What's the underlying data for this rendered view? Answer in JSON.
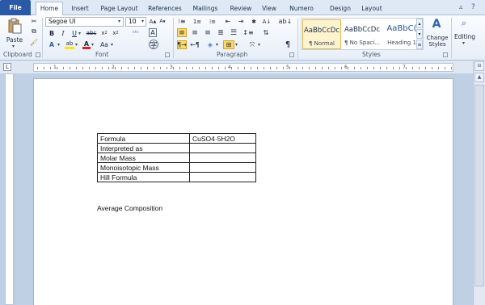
{
  "tabs": {
    "file": "File",
    "items": [
      "Home",
      "Insert",
      "Page Layout",
      "References",
      "Mailings",
      "Review",
      "View",
      "Numero",
      "Design",
      "Layout"
    ]
  },
  "clipboard": {
    "paste": "Paste",
    "label": "Clipboard"
  },
  "font": {
    "name": "Segoe UI",
    "size": "10",
    "label": "Font"
  },
  "paragraph": {
    "label": "Paragraph"
  },
  "styles": {
    "label": "Styles",
    "items": [
      {
        "sample": "AaBbCcDc",
        "name": "¶ Normal"
      },
      {
        "sample": "AaBbCcDc",
        "name": "¶ No Spaci..."
      },
      {
        "sample": "AaBbC(",
        "name": "Heading 1"
      }
    ],
    "change": "Change Styles"
  },
  "editing": {
    "label": "Editing"
  },
  "ruler": {
    "marks": [
      "1",
      "2",
      "3",
      "4",
      "5",
      "6",
      "7"
    ]
  },
  "document": {
    "table": [
      [
        "Formula",
        "CuSO4·5H2O"
      ],
      [
        "Interpreted as",
        ""
      ],
      [
        "Molar Mass",
        ""
      ],
      [
        "Monoisotopic Mass",
        ""
      ],
      [
        "Hill Formula",
        ""
      ]
    ],
    "paragraph": "Average Composition"
  },
  "icons": [
    "cut-icon",
    "copy-icon",
    "format-painter-icon",
    "bold-icon",
    "italic-icon",
    "underline-icon",
    "strikethrough-icon",
    "subscript-icon",
    "superscript-icon",
    "clear-format-icon",
    "font-color-icon",
    "highlight-icon",
    "bullets-icon",
    "numbering-icon",
    "align-left-icon",
    "center-icon",
    "align-right-icon",
    "justify-icon",
    "pilcrow-icon",
    "find-icon"
  ]
}
